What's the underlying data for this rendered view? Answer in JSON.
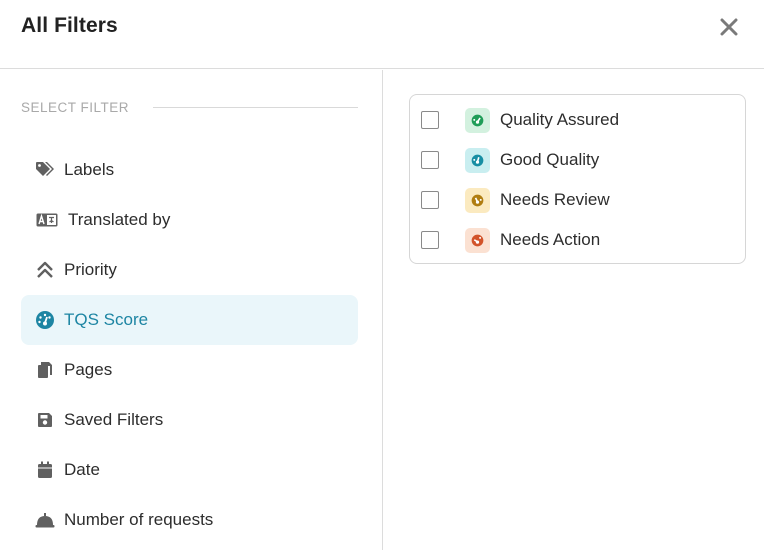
{
  "dialog": {
    "title": "All Filters",
    "close_icon": "close-icon"
  },
  "sidebar": {
    "section_label": "SELECT FILTER",
    "active_index": 3,
    "items": [
      {
        "label": "Labels",
        "icon": "tags-icon"
      },
      {
        "label": "Translated by",
        "icon": "translate-icon"
      },
      {
        "label": "Priority",
        "icon": "double-chevron-up-icon"
      },
      {
        "label": "TQS Score",
        "icon": "gauge-icon"
      },
      {
        "label": "Pages",
        "icon": "pages-icon"
      },
      {
        "label": "Saved Filters",
        "icon": "floppy-disk-icon"
      },
      {
        "label": "Date",
        "icon": "calendar-icon"
      },
      {
        "label": "Number of requests",
        "icon": "bell-icon"
      }
    ]
  },
  "tqs_options": [
    {
      "label": "Quality Assured",
      "checked": false,
      "color": "#1f9d57",
      "bg": "#d3f1df"
    },
    {
      "label": "Good Quality",
      "checked": false,
      "color": "#178ea3",
      "bg": "#c9eef0"
    },
    {
      "label": "Needs Review",
      "checked": false,
      "color": "#b07d10",
      "bg": "#fbeac0"
    },
    {
      "label": "Needs Action",
      "checked": false,
      "color": "#d2532a",
      "bg": "#fbe1d2"
    }
  ],
  "colors": {
    "accent": "#1d85a3",
    "active_bg": "#eaf6fa",
    "icon": "#5f5f5f"
  }
}
